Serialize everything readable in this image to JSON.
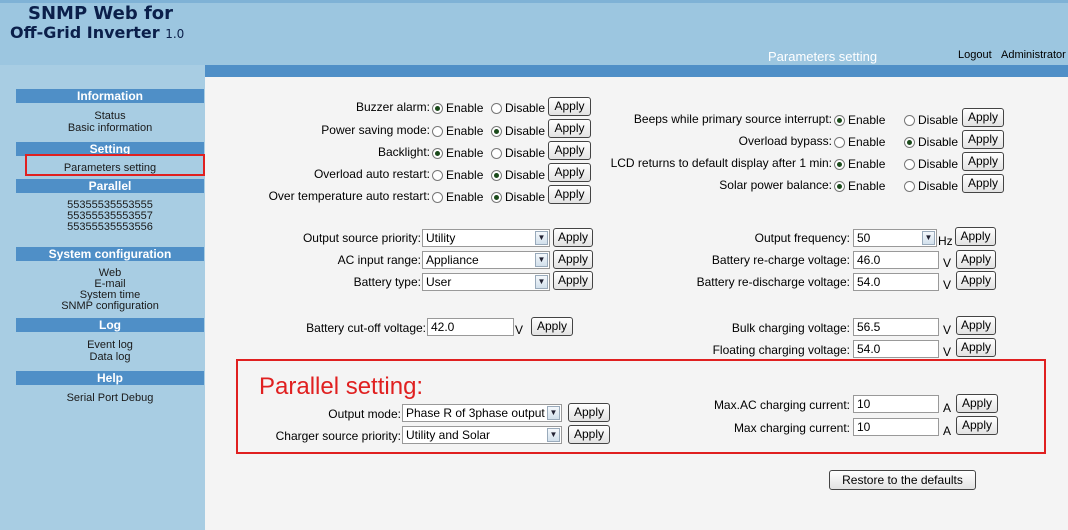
{
  "header": {
    "brand_line1": "SNMP Web for",
    "brand_line2": "Off-Grid Inverter",
    "version": "1.0",
    "page_title": "Parameters setting",
    "logout": "Logout",
    "user": "Administrator"
  },
  "sidebar": {
    "information": {
      "title": "Information",
      "items": [
        "Status",
        "Basic information"
      ]
    },
    "setting": {
      "title": "Setting",
      "items": [
        "Parameters setting"
      ]
    },
    "parallel": {
      "title": "Parallel",
      "items": [
        "55355535553555",
        "55355535553557",
        "55355535553556"
      ]
    },
    "system_configuration": {
      "title": "System configuration",
      "items": [
        "Web",
        "E-mail",
        "System time",
        "SNMP configuration"
      ]
    },
    "log": {
      "title": "Log",
      "items": [
        "Event log",
        "Data log"
      ]
    },
    "help": {
      "title": "Help",
      "items": [
        "Serial Port Debug"
      ]
    }
  },
  "radio_options": {
    "enable": "Enable",
    "disable": "Disable"
  },
  "apply_label": "Apply",
  "toggles_left": [
    {
      "label": "Buzzer alarm:",
      "value": "Enable"
    },
    {
      "label": "Power saving mode:",
      "value": "Disable"
    },
    {
      "label": "Backlight:",
      "value": "Enable"
    },
    {
      "label": "Overload auto restart:",
      "value": "Disable"
    },
    {
      "label": "Over temperature auto restart:",
      "value": "Disable"
    }
  ],
  "toggles_right": [
    {
      "label": "Beeps while primary source interrupt:",
      "value": "Enable"
    },
    {
      "label": "Overload bypass:",
      "value": "Disable"
    },
    {
      "label": "LCD returns to default display after 1 min:",
      "value": "Enable"
    },
    {
      "label": "Solar power balance:",
      "value": "Enable"
    }
  ],
  "selects_left": [
    {
      "label": "Output source priority:",
      "value": "Utility"
    },
    {
      "label": "AC input range:",
      "value": "Appliance"
    },
    {
      "label": "Battery type:",
      "value": "User"
    }
  ],
  "cutoff": {
    "label": "Battery cut-off voltage:",
    "value": "42.0",
    "unit": "V"
  },
  "output_frequency": {
    "label": "Output frequency:",
    "value": "50",
    "unit": "Hz"
  },
  "voltages_right": [
    {
      "label": "Battery re-charge voltage:",
      "value": "46.0",
      "unit": "V"
    },
    {
      "label": "Battery re-discharge voltage:",
      "value": "54.0",
      "unit": "V"
    },
    {
      "label": "Bulk charging voltage:",
      "value": "56.5",
      "unit": "V"
    },
    {
      "label": "Floating charging voltage:",
      "value": "54.0",
      "unit": "V"
    }
  ],
  "parallel_section": {
    "heading": "Parallel setting:",
    "output_mode": {
      "label": "Output mode:",
      "value": "Phase R of 3phase output"
    },
    "charger_source": {
      "label": "Charger source priority:",
      "value": "Utility and Solar"
    },
    "max_ac_current": {
      "label": "Max.AC charging current:",
      "value": "10",
      "unit": "A"
    },
    "max_current": {
      "label": "Max charging current:",
      "value": "10",
      "unit": "A"
    }
  },
  "restore_label": "Restore to the defaults"
}
